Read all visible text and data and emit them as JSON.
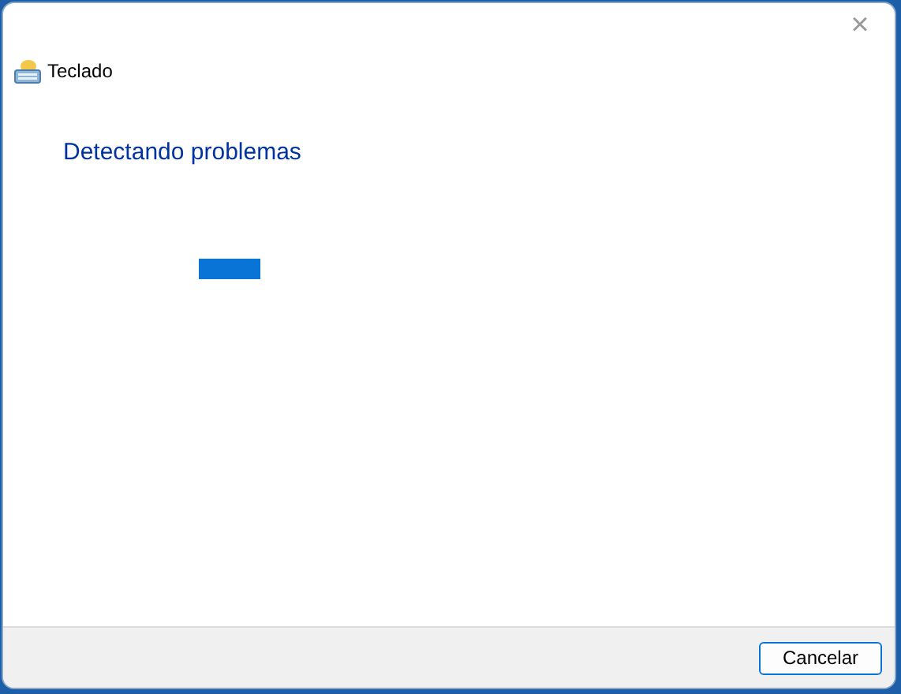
{
  "window": {
    "title": "Teclado",
    "close": "×"
  },
  "heading": "Detectando problemas",
  "progress": {
    "kind": "marquee"
  },
  "buttons": [
    "Cancelar"
  ]
}
